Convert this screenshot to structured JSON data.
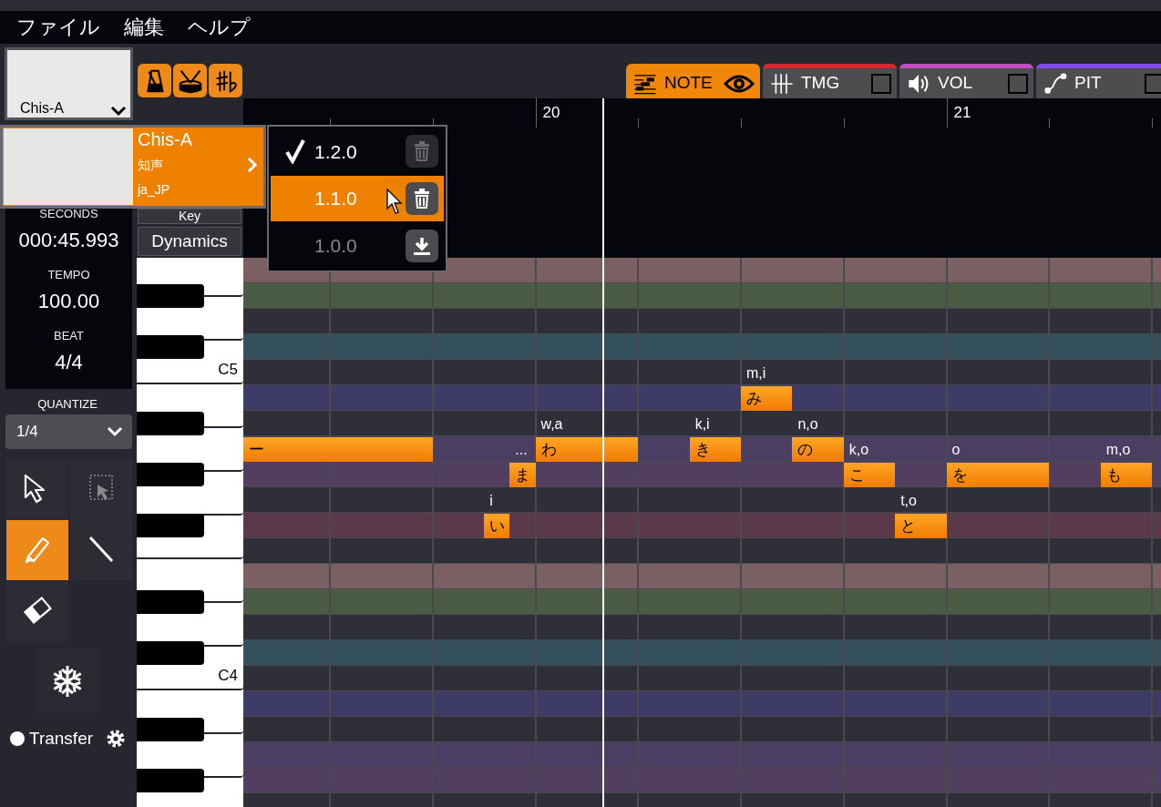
{
  "menu": [
    {
      "label": "ファイル"
    },
    {
      "label": "編集"
    },
    {
      "label": "ヘルプ"
    }
  ],
  "singer": {
    "name": "Chis-A"
  },
  "singer_popup": {
    "name": "Chis-A",
    "voice": "知声",
    "locale": "ja_JP"
  },
  "versions": [
    {
      "label": "1.2.0",
      "checked": true,
      "highlighted": false,
      "installed": true
    },
    {
      "label": "1.1.0",
      "checked": false,
      "highlighted": true,
      "installed": true
    },
    {
      "label": "1.0.0",
      "checked": false,
      "highlighted": false,
      "installed": false
    }
  ],
  "info": [
    {
      "label": "SECONDS",
      "value": "000:45.993"
    },
    {
      "label": "TEMPO",
      "value": "100.00"
    },
    {
      "label": "BEAT",
      "value": "4/4"
    }
  ],
  "quantize": {
    "label": "QUANTIZE",
    "value": "1/4"
  },
  "tools": [
    {
      "kind": "pointer",
      "selected": false,
      "disabled": false
    },
    {
      "kind": "box-select",
      "selected": false,
      "disabled": true
    },
    {
      "kind": "pencil",
      "selected": true,
      "disabled": false
    },
    {
      "kind": "line",
      "selected": false,
      "disabled": false
    },
    {
      "kind": "eraser",
      "selected": false,
      "disabled": false
    }
  ],
  "transfer": {
    "label": "Transfer"
  },
  "track_buttons": [
    {
      "label": "Key"
    },
    {
      "label": "Dynamics"
    }
  ],
  "tabs": [
    {
      "kind": "note",
      "label": "NOTE",
      "selected": true,
      "color": "#f0860a"
    },
    {
      "kind": "timing",
      "label": "TMG",
      "selected": false,
      "checked": false,
      "color": "#d9282e"
    },
    {
      "kind": "volume",
      "label": "VOL",
      "selected": false,
      "checked": false,
      "color": "#c04ec0"
    },
    {
      "kind": "pitch",
      "label": "PIT",
      "selected": false,
      "checked": false,
      "color": "#7f4cf0"
    }
  ],
  "ruler": {
    "bars": [
      {
        "label": "20"
      },
      {
        "label": "21"
      }
    ]
  },
  "piano": {
    "labels": [
      "C5",
      "C4"
    ]
  },
  "notes": [
    {
      "lyric": "ー"
    },
    {
      "lyric": "い",
      "phoneme": "i"
    },
    {
      "lyric": "ま",
      "phoneme": "..."
    },
    {
      "lyric": "わ",
      "phoneme": "w,a"
    },
    {
      "lyric": "き",
      "phoneme": "k,i"
    },
    {
      "lyric": "み",
      "phoneme": "m,i"
    },
    {
      "lyric": "の",
      "phoneme": "n,o"
    },
    {
      "lyric": "こ",
      "phoneme": "k,o"
    },
    {
      "lyric": "と",
      "phoneme": "t,o"
    },
    {
      "lyric": "を",
      "phoneme": "o"
    },
    {
      "lyric": "も",
      "phoneme": "m,o"
    }
  ]
}
